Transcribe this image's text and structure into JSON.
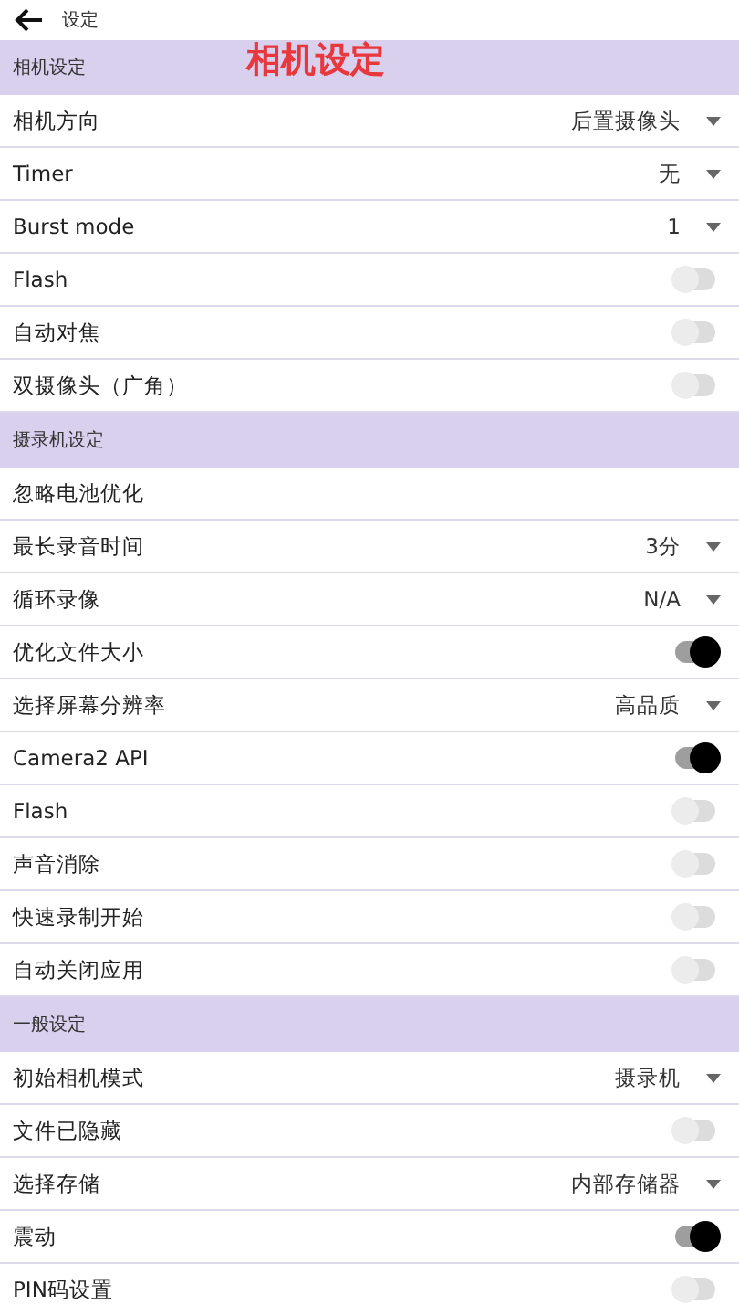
{
  "header": {
    "title": "设定"
  },
  "annotation": "相机设定",
  "sections": [
    {
      "title": "相机设定",
      "rows": [
        {
          "kind": "select",
          "label": "相机方向",
          "value": "后置摄像头"
        },
        {
          "kind": "select",
          "label": "Timer",
          "value": "无"
        },
        {
          "kind": "select",
          "label": "Burst mode",
          "value": "1"
        },
        {
          "kind": "toggle",
          "label": "Flash",
          "on": false
        },
        {
          "kind": "toggle",
          "label": "自动对焦",
          "on": false
        },
        {
          "kind": "toggle",
          "label": "双摄像头（广角）",
          "on": false
        }
      ]
    },
    {
      "title": "摄录机设定",
      "rows": [
        {
          "kind": "plain",
          "label": "忽略电池优化"
        },
        {
          "kind": "select",
          "label": "最长录音时间",
          "value": "3分"
        },
        {
          "kind": "select",
          "label": "循环录像",
          "value": "N/A"
        },
        {
          "kind": "toggle",
          "label": "优化文件大小",
          "on": true
        },
        {
          "kind": "select",
          "label": "选择屏幕分辨率",
          "value": "高品质"
        },
        {
          "kind": "toggle",
          "label": "Camera2 API",
          "on": true
        },
        {
          "kind": "toggle",
          "label": "Flash",
          "on": false
        },
        {
          "kind": "toggle",
          "label": "声音消除",
          "on": false
        },
        {
          "kind": "toggle",
          "label": "快速录制开始",
          "on": false
        },
        {
          "kind": "toggle",
          "label": "自动关闭应用",
          "on": false
        }
      ]
    },
    {
      "title": "一般设定",
      "rows": [
        {
          "kind": "select",
          "label": "初始相机模式",
          "value": "摄录机"
        },
        {
          "kind": "toggle",
          "label": "文件已隐藏",
          "on": false
        },
        {
          "kind": "select",
          "label": "选择存储",
          "value": "内部存储器"
        },
        {
          "kind": "toggle",
          "label": "震动",
          "on": true
        },
        {
          "kind": "toggle",
          "label": "PIN码设置",
          "on": false
        }
      ]
    }
  ]
}
